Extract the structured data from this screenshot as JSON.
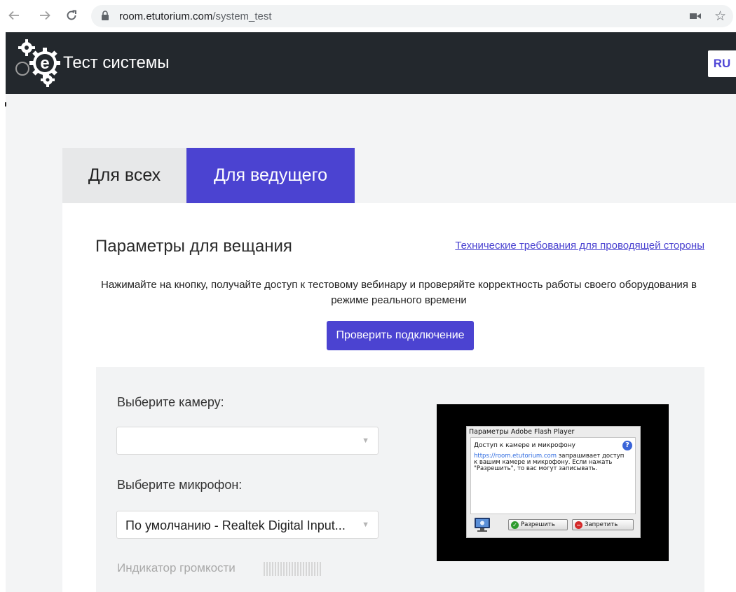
{
  "browser": {
    "url_host": "room.etutorium.com",
    "url_path": "/system_test",
    "icons": [
      "back-icon",
      "forward-icon",
      "reload-icon",
      "lock-icon",
      "camera-icon",
      "star-icon"
    ]
  },
  "header": {
    "title": "Тест системы",
    "lang": "RU",
    "logo_letter": "e"
  },
  "tabs": [
    {
      "label": "Для всех",
      "active": false
    },
    {
      "label": "Для ведущего",
      "active": true
    }
  ],
  "main": {
    "section_title": "Параметры для вещания",
    "requirements_link": "Технические требования для проводящей стороны",
    "description": "Нажимайте на кнопку, получайте доступ к тестовому вебинару и проверяйте корректность работы своего оборудования в режиме реального времени",
    "check_button": "Проверить подключение"
  },
  "settings": {
    "camera_label": "Выберите камеру:",
    "camera_value": "",
    "mic_label": "Выберите микрофон:",
    "mic_value": "По умолчанию - Realtek Digital Input...",
    "volume_label": "Индикатор громкости",
    "volume_level": 0
  },
  "flash_dialog": {
    "title": "Параметры Adobe Flash Player",
    "heading": "Доступ к камере и микрофону",
    "help": "?",
    "url": "https://room.etutorium.com",
    "text_after_url": " запрашивает доступ к вашим камере и микрофону. Если нажать \"Разрешить\", то вас могут записывать.",
    "allow_label": "Разрешить",
    "deny_label": "Запретить"
  },
  "colors": {
    "accent": "#4b43d1",
    "header_bg": "#23282d",
    "page_bg": "#f3f4f5"
  }
}
